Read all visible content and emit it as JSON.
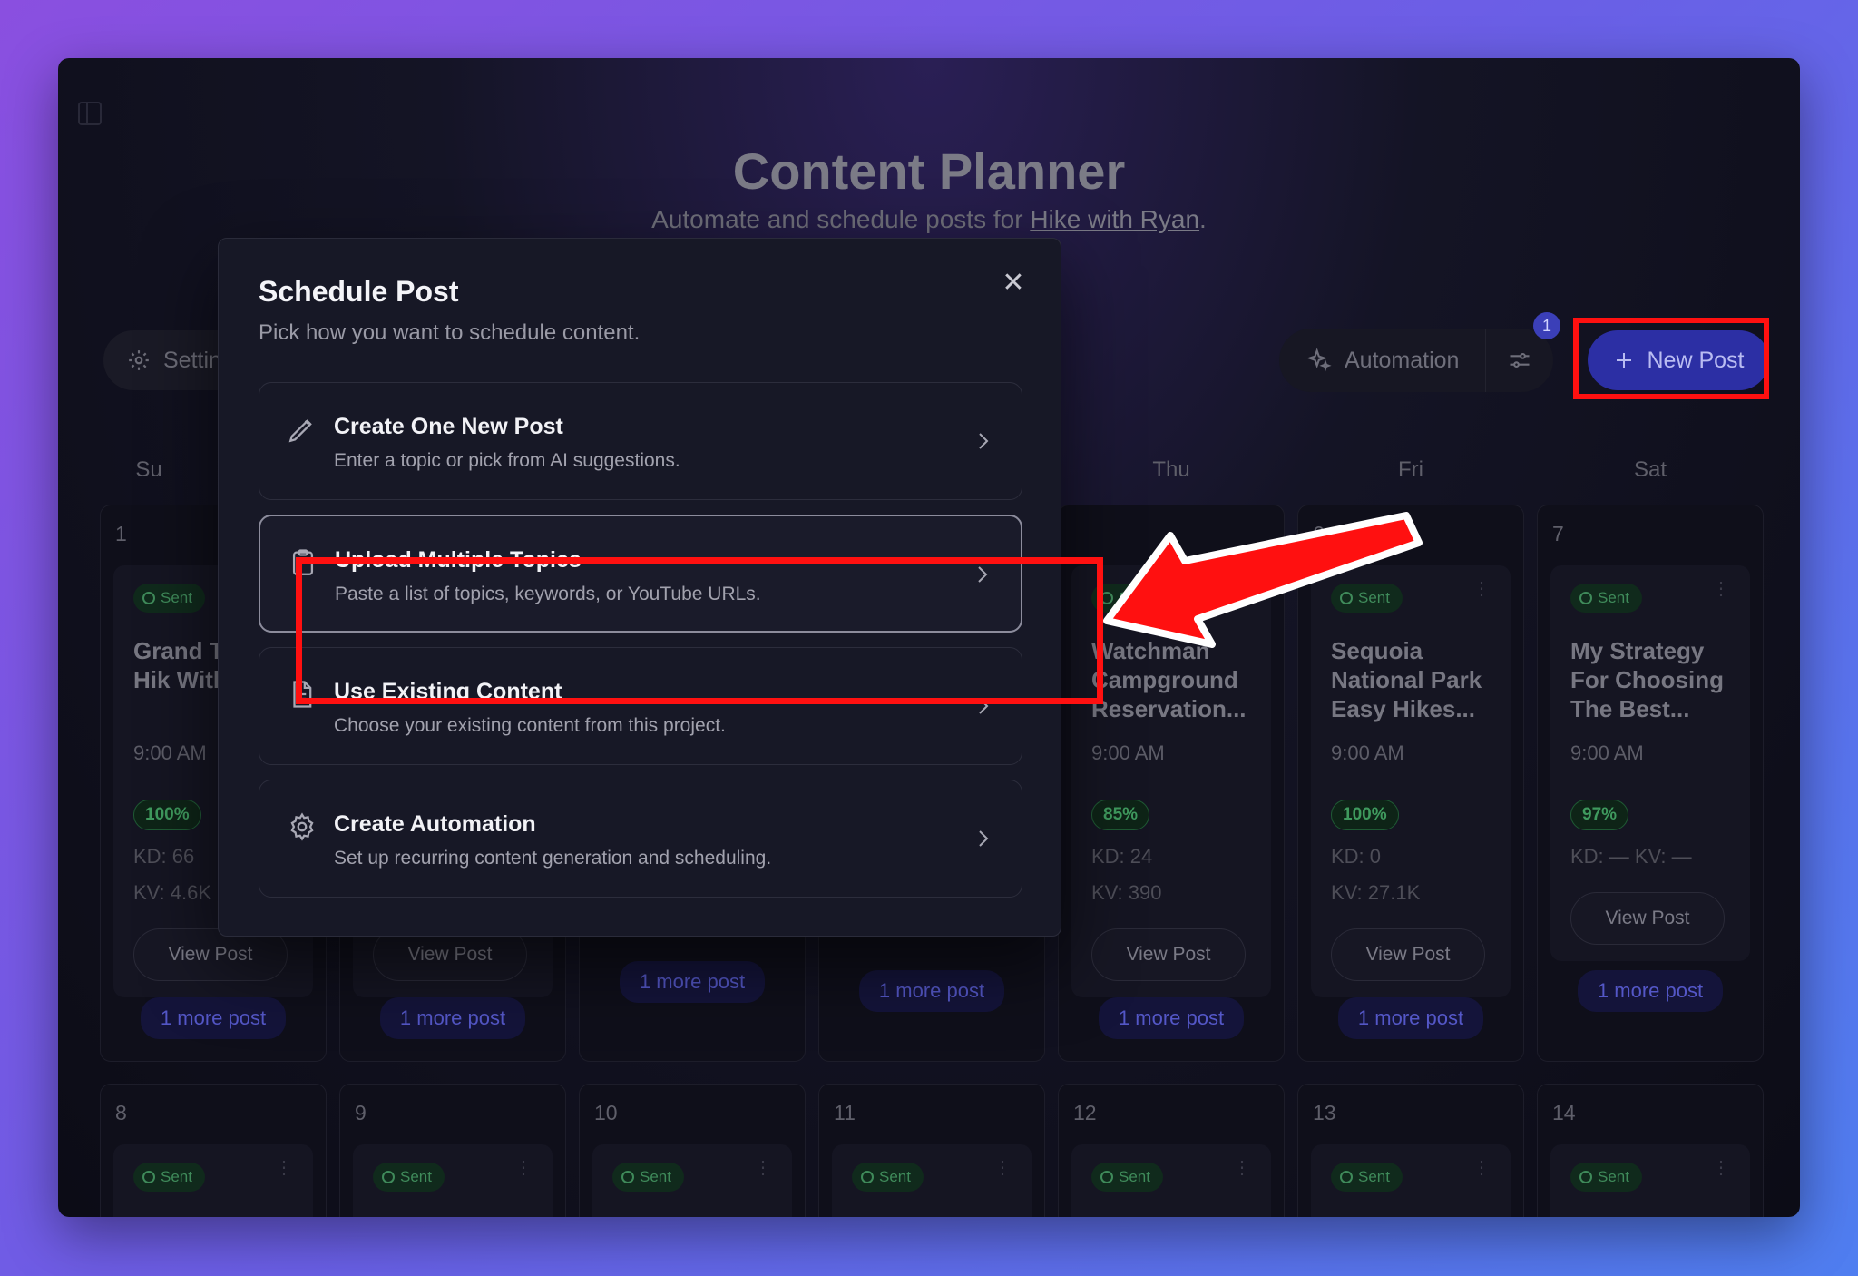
{
  "app": {
    "title": "Content Planner",
    "subtitle_prefix": "Automate and schedule posts for ",
    "subtitle_link": "Hike with Ryan",
    "subtitle_suffix": "."
  },
  "header": {
    "settings_label": "Settings",
    "automation_label": "Automation",
    "badge_count": "1",
    "new_post_label": "New Post"
  },
  "calendar": {
    "day_headers": [
      "Su",
      "Thu",
      "Fri",
      "Sat"
    ],
    "week1": [
      {
        "num": "1",
        "status": "Sent",
        "title": "Grand T Day Hik With Si",
        "time": "9:00 AM",
        "score": "100%",
        "kd": "KD: 66",
        "kv": "KV: 4.6K",
        "view": "View Post",
        "more": "1 more post"
      },
      {
        "num": "",
        "view": "View Post",
        "more": "1 more post"
      },
      {
        "num": "",
        "more": "1 more post"
      },
      {
        "num": "",
        "more": "1 more post"
      },
      {
        "num": "",
        "status": "Sent",
        "title": "Watchman Campground Reservation...",
        "time": "9:00 AM",
        "score": "85%",
        "kd": "KD: 24",
        "kv": "KV: 390",
        "view": "View Post",
        "more": "1 more post"
      },
      {
        "num": "6",
        "status": "Sent",
        "title": "Sequoia National Park Easy Hikes...",
        "time": "9:00 AM",
        "score": "100%",
        "kd": "KD: 0",
        "kv": "KV: 27.1K",
        "view": "View Post",
        "more": "1 more post"
      },
      {
        "num": "7",
        "status": "Sent",
        "title": "My Strategy For Choosing The Best...",
        "time": "9:00 AM",
        "score": "97%",
        "kd": "KD: — KV: —",
        "view": "View Post",
        "more": "1 more post"
      }
    ],
    "week2": [
      {
        "num": "8",
        "status": "Sent"
      },
      {
        "num": "9",
        "status": "Sent"
      },
      {
        "num": "10",
        "status": "Sent"
      },
      {
        "num": "11",
        "status": "Sent"
      },
      {
        "num": "12",
        "status": "Sent"
      },
      {
        "num": "13",
        "status": "Sent"
      },
      {
        "num": "14",
        "status": "Sent"
      }
    ]
  },
  "modal": {
    "title": "Schedule Post",
    "subtitle": "Pick how you want to schedule content.",
    "close_glyph": "✕",
    "options": [
      {
        "title": "Create One New Post",
        "desc": "Enter a topic or pick from AI suggestions.",
        "icon": "pencil-icon"
      },
      {
        "title": "Upload Multiple Topics",
        "desc": "Paste a list of topics, keywords, or YouTube URLs.",
        "icon": "clipboard-icon"
      },
      {
        "title": "Use Existing Content",
        "desc": "Choose your existing content from this project.",
        "icon": "document-icon"
      },
      {
        "title": "Create Automation",
        "desc": "Set up recurring content generation and scheduling.",
        "icon": "gear-icon"
      }
    ]
  },
  "colors": {
    "highlight": "#ff1010",
    "accent": "#2c2fa4",
    "sent_green": "#3f8a5a"
  }
}
